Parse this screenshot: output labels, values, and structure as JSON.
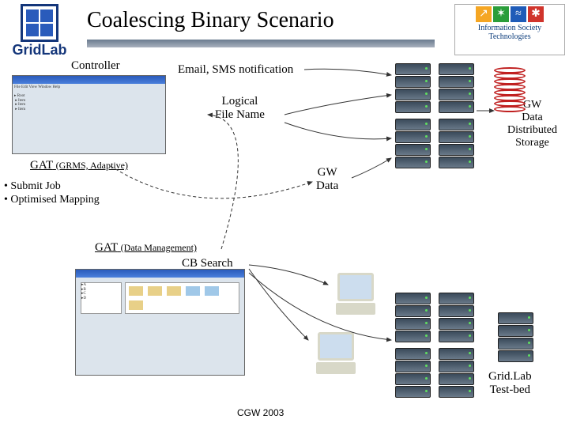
{
  "title": "Coalescing Binary Scenario",
  "footer": "CGW 2003",
  "labels": {
    "controller": "Controller",
    "email_sms": "Email, SMS notification",
    "logical_file": "Logical\nFile Name",
    "gat_grms": "GAT",
    "gat_grms_sub": "(GRMS, Adaptive)",
    "submit_job": "• Submit Job",
    "optimised": "• Optimised Mapping",
    "gw_data": "GW\nData",
    "gw_data_dist": "GW\nData\nDistributed\nStorage",
    "gat_dm": "GAT",
    "gat_dm_sub": "(Data Management)",
    "cb_search": "CB Search",
    "testbed": "Grid.Lab\nTest-bed"
  },
  "logos": {
    "gridlab": "GridLab",
    "ist_line1": "Information Society",
    "ist_line2": "Technologies"
  }
}
